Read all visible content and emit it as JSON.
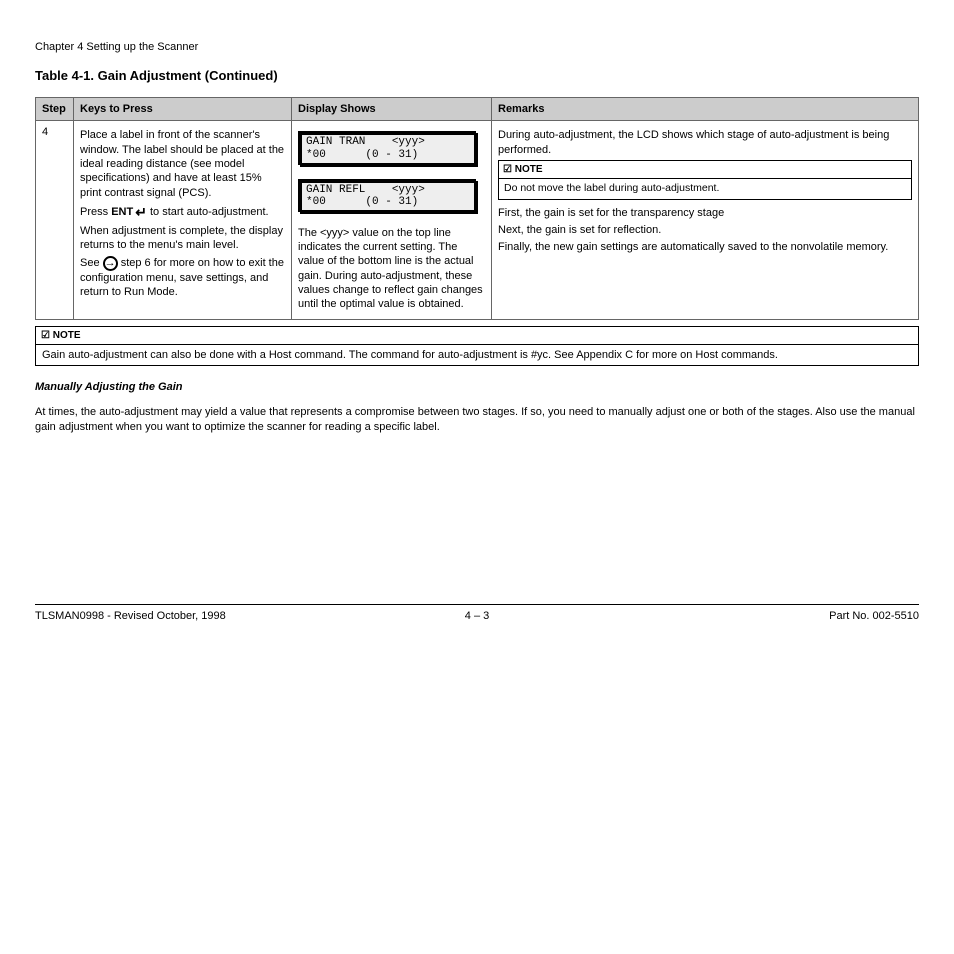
{
  "header": {
    "chapter": "Chapter 4 Setting up the Scanner",
    "section_title": "Table 4-1. Gain Adjustment (Continued)"
  },
  "columns": {
    "step": "Step",
    "key": "Keys to Press",
    "display": "Display Shows",
    "remarks": "Remarks"
  },
  "row": {
    "step": "4",
    "key_p1": "Place a label in front of the scanner's window. The label should be placed at the ideal reading distance (see model specifications) and have at least 15% print contrast signal (PCS).",
    "key_p2a": "Press ",
    "key_ent": "ENT",
    "key_p2b": " to start auto-adjustment.",
    "key_p3": "When adjustment is complete, the display returns to the menu's main level.",
    "key_p4a": "See ",
    "key_arrow": "→",
    "key_p4b": " for more on how to exit the configuration menu, save settings, and return to Run Mode.",
    "key_step6": "step 6",
    "lcd1_l1": "GAIN TRAN    <yyy>",
    "lcd1_l2": "*00      (0 - 31)",
    "lcd2_l1": "GAIN REFL    <yyy>",
    "lcd2_l2": "*00      (0 - 31)",
    "lcd_note": "The <yyy> value on the top line indicates the current setting. The value of the bottom line is the actual gain. During auto-adjustment, these values change to reflect gain changes until the optimal value is obtained.",
    "remarks_p1": "During auto-adjustment, the LCD shows which stage of auto-adjustment is being performed.",
    "remarks_note_head": "NOTE",
    "remarks_note_body": "Do not move the label during auto-adjustment.",
    "remarks_p2": "First, the gain is set for the transparency stage",
    "remarks_p3": "Next, the gain is set for reflection.",
    "remarks_p4": "Finally, the new gain settings are automatically saved to the nonvolatile memory."
  },
  "outer_note": {
    "head": "NOTE",
    "body": "Gain auto-adjustment can also be done with a Host command. The command for auto-adjustment is #yc. See Appendix C for more on Host commands."
  },
  "post_title": "Manually Adjusting the Gain",
  "post_body": "At times, the auto-adjustment may yield a value that represents a compromise between two stages. If so, you need to manually adjust one or both of the stages. Also use the manual gain adjustment when you want to optimize the scanner for reading a specific label.",
  "footer": {
    "left": "TLSMAN0998 - Revised October, 1998",
    "center": "4 – 3",
    "right": "Part No. 002-5510"
  }
}
